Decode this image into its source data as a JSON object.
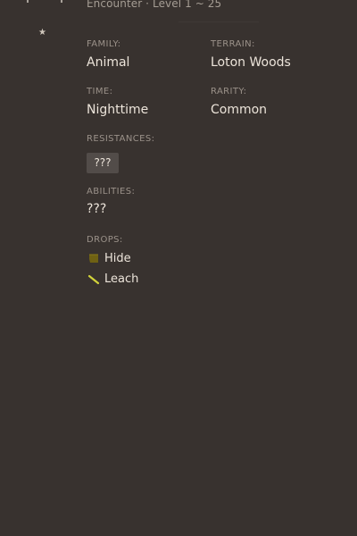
{
  "header": {
    "subtitle": "Encounter · Level 1 ~ 25",
    "icons": {
      "monster": "monster-icon",
      "favorite": "star-icon"
    }
  },
  "details": {
    "family": {
      "label": "FAMILY:",
      "value": "Animal"
    },
    "terrain": {
      "label": "TERRAIN:",
      "value": "Loton Woods"
    },
    "time": {
      "label": "TIME:",
      "value": "Nighttime"
    },
    "rarity": {
      "label": "RARITY:",
      "value": "Common"
    },
    "resistances": {
      "label": "RESISTANCES:",
      "chip": "???"
    },
    "abilities": {
      "label": "ABILITIES:",
      "value": "???"
    },
    "drops": {
      "label": "DROPS:",
      "items": [
        {
          "label": "Hide",
          "icon": "hide-icon"
        },
        {
          "label": "Leach",
          "icon": "leach-icon"
        }
      ]
    }
  },
  "colors": {
    "background": "#38322f",
    "text": "#ece4da",
    "label": "#9b928a",
    "chip": "#524c49",
    "hide_icon": "#6f6113",
    "leach_icon": "#d2d33a"
  }
}
